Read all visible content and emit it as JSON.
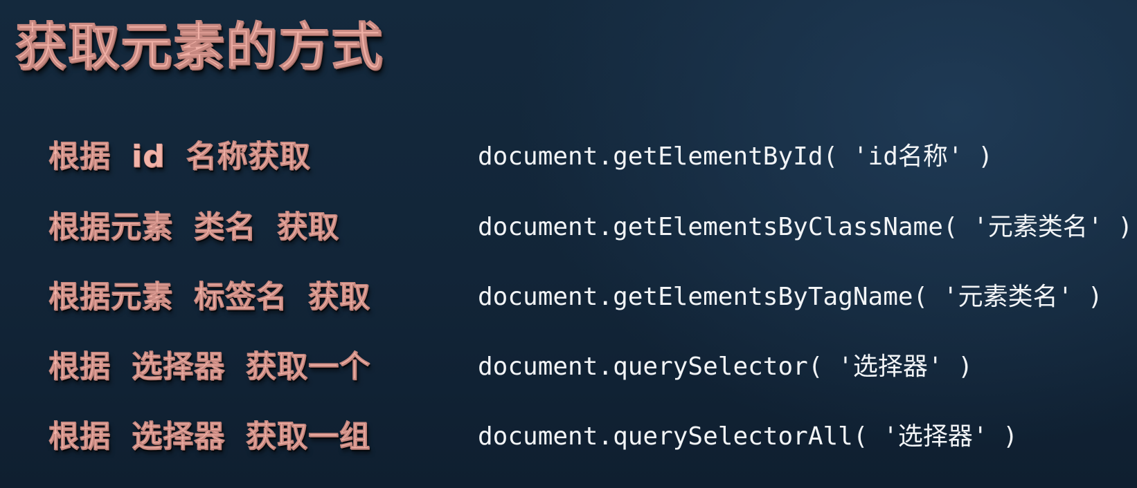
{
  "slide": {
    "title": "获取元素的方式",
    "rows": [
      {
        "label_parts": [
          "根据",
          "id",
          "名称获取"
        ],
        "code": "document.getElementById( 'id名称' )"
      },
      {
        "label_parts": [
          "根据元素",
          "类名",
          "获取"
        ],
        "code": "document.getElementsByClassName( '元素类名' )"
      },
      {
        "label_parts": [
          "根据元素",
          "标签名",
          "获取"
        ],
        "code": "document.getElementsByTagName( '元素类名' )"
      },
      {
        "label_parts": [
          "根据",
          "选择器",
          "获取一个"
        ],
        "code": "document.querySelector( '选择器' )"
      },
      {
        "label_parts": [
          "根据",
          "选择器",
          "获取一组"
        ],
        "code": "document.querySelectorAll( '选择器' )"
      }
    ]
  },
  "colors": {
    "background": "#14293d",
    "title_pink": "#f0b0a6",
    "code_white": "#f2f4f6"
  }
}
